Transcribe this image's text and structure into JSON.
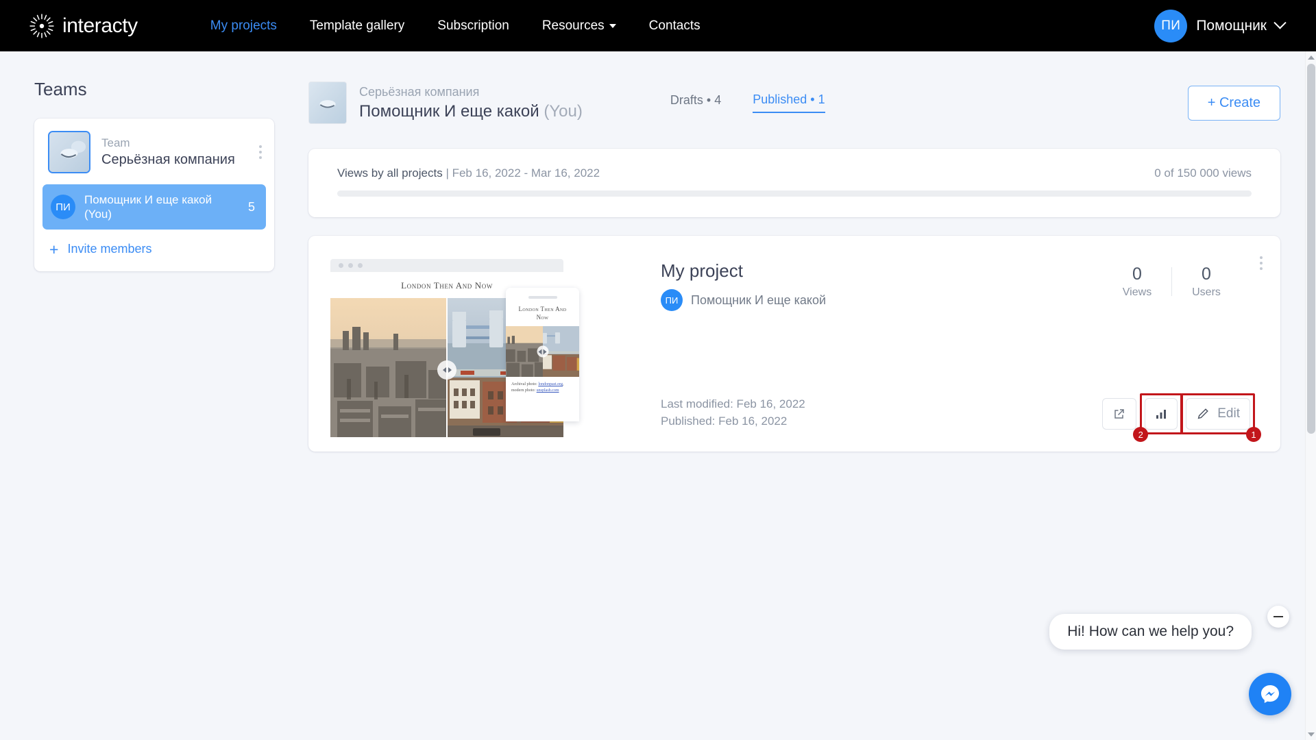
{
  "header": {
    "brand": "interacty",
    "logo_icon": "sunburst-logo-icon",
    "nav": [
      {
        "label": "My projects",
        "active": true,
        "has_caret": false
      },
      {
        "label": "Template gallery",
        "active": false,
        "has_caret": false
      },
      {
        "label": "Subscription",
        "active": false,
        "has_caret": false
      },
      {
        "label": "Resources",
        "active": false,
        "has_caret": true
      },
      {
        "label": "Contacts",
        "active": false,
        "has_caret": false
      }
    ],
    "user": {
      "initials": "ПИ",
      "name": "Помощник",
      "caret_icon": "chevron-down-icon"
    },
    "accent": "#3b8cf4",
    "background": "#000000"
  },
  "sidebar": {
    "title": "Teams",
    "team": {
      "label": "Team",
      "name": "Серьёзная компания",
      "menu_icon": "kebab-menu-icon"
    },
    "members": [
      {
        "initials": "ПИ",
        "name": "Помощник И еще какой (You)",
        "count": "5",
        "selected": true
      }
    ],
    "invite": {
      "label": "Invite members",
      "icon": "plus-icon"
    }
  },
  "project_header": {
    "team_name": "Серьёзная компания",
    "user_name": "Помощник И еще какой",
    "you_suffix": "(You)",
    "tabs": [
      {
        "label": "Drafts",
        "separator": "•",
        "count": "4",
        "active": false
      },
      {
        "label": "Published",
        "separator": "•",
        "count": "1",
        "active": true
      }
    ],
    "create_button": "+ Create"
  },
  "views_panel": {
    "title": "Views by all projects",
    "separator": "|",
    "date_range": "Feb 16, 2022 - Mar 16, 2022",
    "counter": "0 of 150 000 views",
    "progress_percent": 0
  },
  "project": {
    "name": "My project",
    "owner_initials": "ПИ",
    "owner_name": "Помощник И еще какой",
    "stats": [
      {
        "value": "0",
        "label": "Views"
      },
      {
        "value": "0",
        "label": "Users"
      }
    ],
    "last_modified": "Last modified: Feb 16, 2022",
    "published": "Published: Feb 16, 2022",
    "menu_icon": "kebab-menu-icon",
    "actions": [
      {
        "name": "open-external",
        "icon": "external-link-icon",
        "label": "",
        "highlight": null
      },
      {
        "name": "statistics",
        "icon": "bar-chart-icon",
        "label": "",
        "highlight": "2"
      },
      {
        "name": "edit",
        "icon": "pencil-icon",
        "label": "Edit",
        "highlight": "1"
      }
    ],
    "preview": {
      "browser_title": "London Then And Now",
      "phone_title": "London Then And Now",
      "phone_caption_prefix": "Archival photo: ",
      "phone_caption_link1": "londonpast.org",
      "phone_caption_mid": ", modern photo: ",
      "phone_caption_link2": "unsplash.com"
    }
  },
  "chat": {
    "message": "Hi! How can we help you?",
    "minimize_icon": "minimize-icon",
    "fab_icon": "messenger-icon",
    "fab_color": "#1f82f5"
  },
  "highlights": [
    {
      "id": "1",
      "target": "edit-button",
      "color": "#c2161b"
    },
    {
      "id": "2",
      "target": "statistics-button",
      "color": "#c2161b"
    }
  ]
}
